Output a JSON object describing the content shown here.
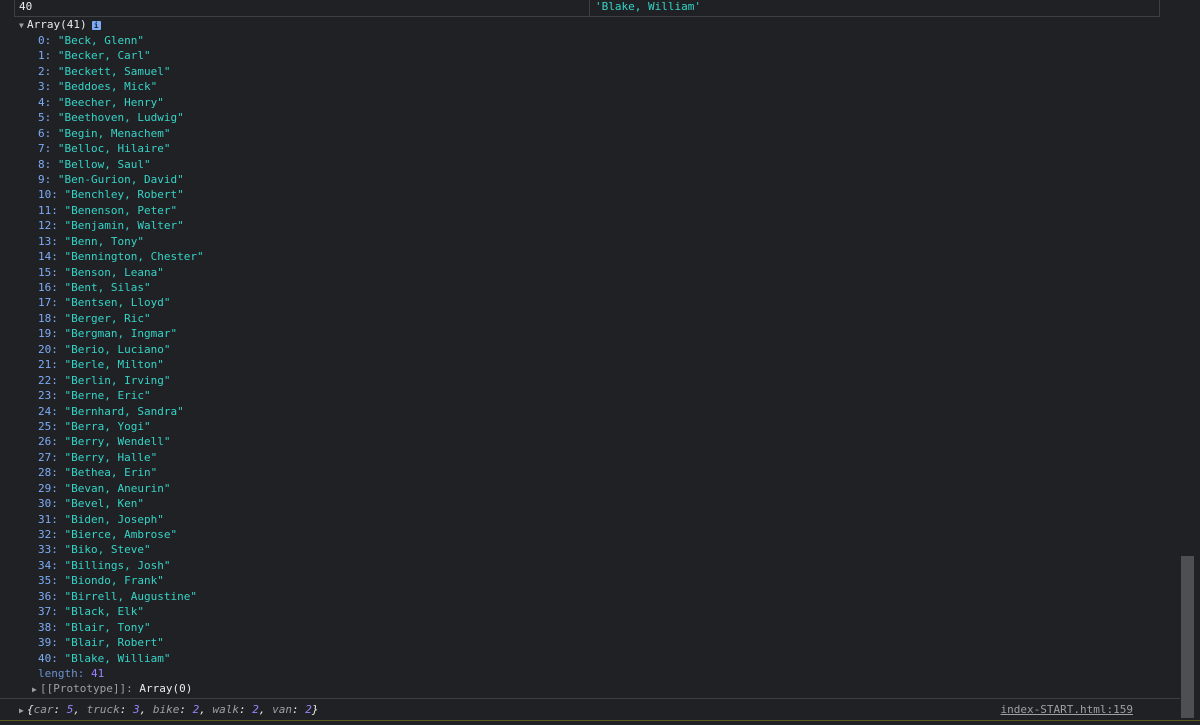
{
  "top_row": {
    "left": "40",
    "right": "'Blake, William'"
  },
  "array": {
    "header": "Array(41)",
    "info_icon": "i",
    "items": [
      "\"Beck, Glenn\"",
      "\"Becker, Carl\"",
      "\"Beckett, Samuel\"",
      "\"Beddoes, Mick\"",
      "\"Beecher, Henry\"",
      "\"Beethoven, Ludwig\"",
      "\"Begin, Menachem\"",
      "\"Belloc, Hilaire\"",
      "\"Bellow, Saul\"",
      "\"Ben-Gurion, David\"",
      "\"Benchley, Robert\"",
      "\"Benenson, Peter\"",
      "\"Benjamin, Walter\"",
      "\"Benn, Tony\"",
      "\"Bennington, Chester\"",
      "\"Benson, Leana\"",
      "\"Bent, Silas\"",
      "\"Bentsen, Lloyd\"",
      "\"Berger, Ric\"",
      "\"Bergman, Ingmar\"",
      "\"Berio, Luciano\"",
      "\"Berle, Milton\"",
      "\"Berlin, Irving\"",
      "\"Berne, Eric\"",
      "\"Bernhard, Sandra\"",
      "\"Berra, Yogi\"",
      "\"Berry, Wendell\"",
      "\"Berry, Halle\"",
      "\"Bethea, Erin\"",
      "\"Bevan, Aneurin\"",
      "\"Bevel, Ken\"",
      "\"Biden, Joseph\"",
      "\"Bierce, Ambrose\"",
      "\"Biko, Steve\"",
      "\"Billings, Josh\"",
      "\"Biondo, Frank\"",
      "\"Birrell, Augustine\"",
      "\"Black, Elk\"",
      "\"Blair, Tony\"",
      "\"Blair, Robert\"",
      "\"Blake, William\""
    ],
    "length_key": "length:",
    "length_value": "41",
    "proto_key": "[[Prototype]]:",
    "proto_value": "Array(0)"
  },
  "object_log": {
    "open": "{",
    "entries": [
      {
        "key": "car",
        "value": "5"
      },
      {
        "key": "truck",
        "value": "3"
      },
      {
        "key": "bike",
        "value": "2"
      },
      {
        "key": "walk",
        "value": "2"
      },
      {
        "key": "van",
        "value": "2"
      }
    ],
    "close": "}"
  },
  "source_link": "index-START.html:159",
  "icons": {
    "expanded": "triangle-down-icon",
    "collapsed": "triangle-right-icon",
    "info": "info-icon"
  }
}
